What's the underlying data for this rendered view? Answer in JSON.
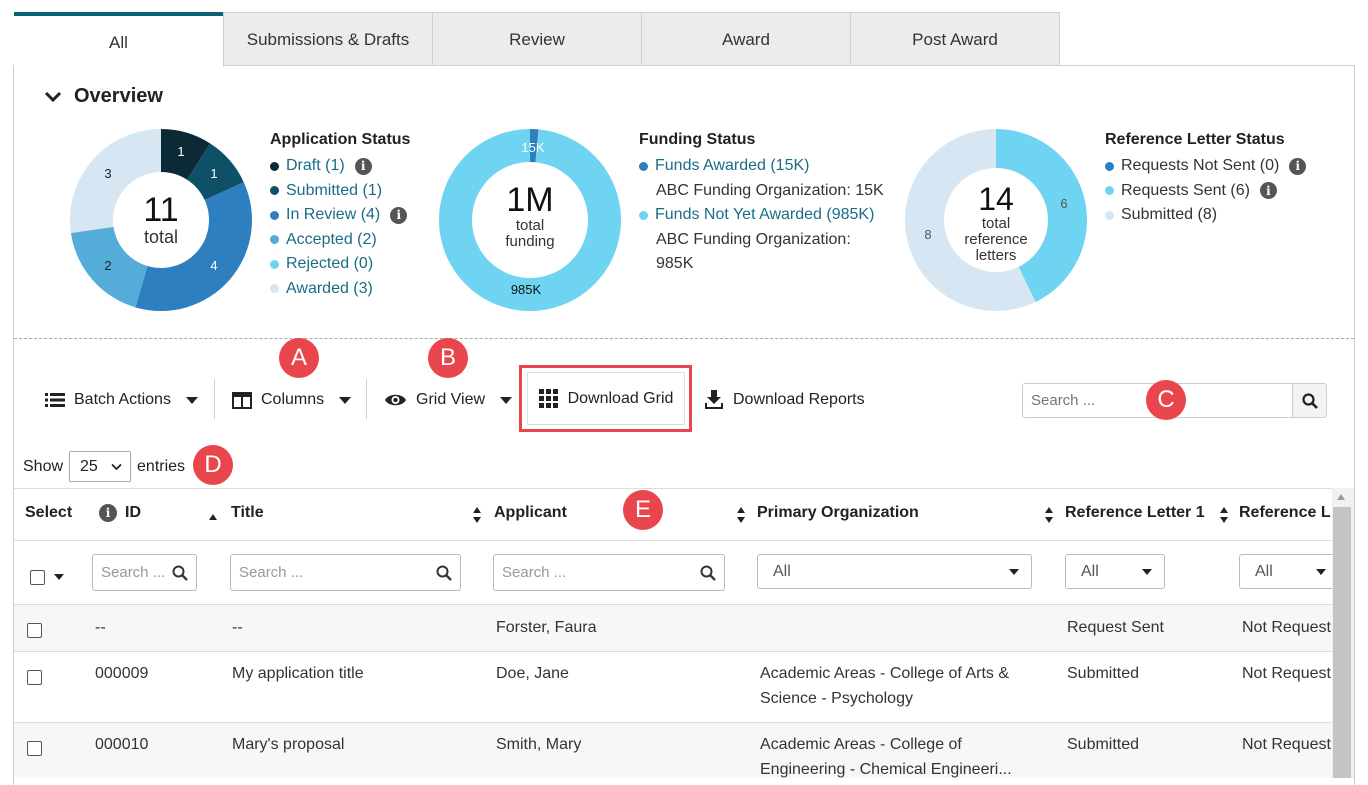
{
  "tabs": [
    {
      "label": "All",
      "active": true
    },
    {
      "label": "Submissions & Drafts",
      "active": false
    },
    {
      "label": "Review",
      "active": false
    },
    {
      "label": "Award",
      "active": false
    },
    {
      "label": "Post Award",
      "active": false
    }
  ],
  "overview": {
    "title": "Overview",
    "application_status": {
      "title": "Application Status",
      "total_value": "11",
      "total_label": "total",
      "segments": [
        {
          "label": "Draft (1)",
          "value": 1,
          "color": "#0b2a36",
          "info": true
        },
        {
          "label": "Submitted (1)",
          "value": 1,
          "color": "#0e5068",
          "info": false
        },
        {
          "label": "In Review (4)",
          "value": 4,
          "color": "#2e7fbf",
          "info": true
        },
        {
          "label": "Accepted (2)",
          "value": 2,
          "color": "#54acd9",
          "info": false
        },
        {
          "label": "Rejected (0)",
          "value": 0,
          "color": "#6fd4f2",
          "info": false
        },
        {
          "label": "Awarded (3)",
          "value": 3,
          "color": "#d6e7f3",
          "info": false
        }
      ],
      "slice_labels": [
        "1",
        "1",
        "4",
        "2",
        "3"
      ]
    },
    "funding_status": {
      "title": "Funding Status",
      "total_value": "1M",
      "total_label_1": "total",
      "total_label_2": "funding",
      "segments": [
        {
          "label": "Funds Awarded (15K)",
          "value": 15,
          "color": "#2e7fbf",
          "sub": "ABC Funding Organization: 15K"
        },
        {
          "label": "Funds Not Yet Awarded (985K)",
          "value": 985,
          "color": "#6fd4f2",
          "sub_1": "ABC Funding Organization:",
          "sub_2": "985K"
        }
      ],
      "slice_labels": [
        "15K",
        "985K"
      ]
    },
    "reference_status": {
      "title": "Reference Letter Status",
      "total_value": "14",
      "total_label_1": "total",
      "total_label_2": "reference",
      "total_label_3": "letters",
      "segments": [
        {
          "label": "Requests Not Sent (0)",
          "value": 0,
          "color": "#2e7fbf",
          "info": true
        },
        {
          "label": "Requests Sent (6)",
          "value": 6,
          "color": "#6fd4f2",
          "info": true
        },
        {
          "label": "Submitted (8)",
          "value": 8,
          "color": "#d6e7f3",
          "info": false
        }
      ],
      "slice_labels": [
        "6",
        "8"
      ]
    }
  },
  "toolbar": {
    "batch_actions": "Batch Actions",
    "columns": "Columns",
    "grid_view": "Grid View",
    "download_grid": "Download Grid",
    "download_reports": "Download Reports",
    "search_placeholder": "Search ..."
  },
  "markers": [
    "A",
    "B",
    "C",
    "D",
    "E"
  ],
  "entries": {
    "show": "Show",
    "value": "25",
    "suffix": "entries"
  },
  "table": {
    "headers": {
      "select": "Select",
      "id": "ID",
      "title": "Title",
      "applicant": "Applicant",
      "primary_org": "Primary Organization",
      "ref1": "Reference Letter 1",
      "ref2": "Reference L"
    },
    "filters": {
      "id_placeholder": "Search ...",
      "title_placeholder": "Search ...",
      "applicant_placeholder": "Search ...",
      "org_value": "All",
      "ref1_value": "All",
      "ref2_value": "All"
    },
    "rows": [
      {
        "id": "--",
        "title": "--",
        "applicant": "Forster, Faura",
        "org_1": "",
        "org_2": "",
        "ref1": "Request Sent",
        "ref2": "Not Request"
      },
      {
        "id": "000009",
        "title": "My application title",
        "applicant": "Doe, Jane",
        "org_1": "Academic Areas - College of Arts &",
        "org_2": "Science - Psychology",
        "ref1": "Submitted",
        "ref2": "Not Request"
      },
      {
        "id": "000010",
        "title": "Mary's proposal",
        "applicant": "Smith, Mary",
        "org_1": "Academic Areas - College of",
        "org_2": "Engineering - Chemical Engineeri...",
        "ref1": "Submitted",
        "ref2": "Not Request"
      }
    ]
  }
}
